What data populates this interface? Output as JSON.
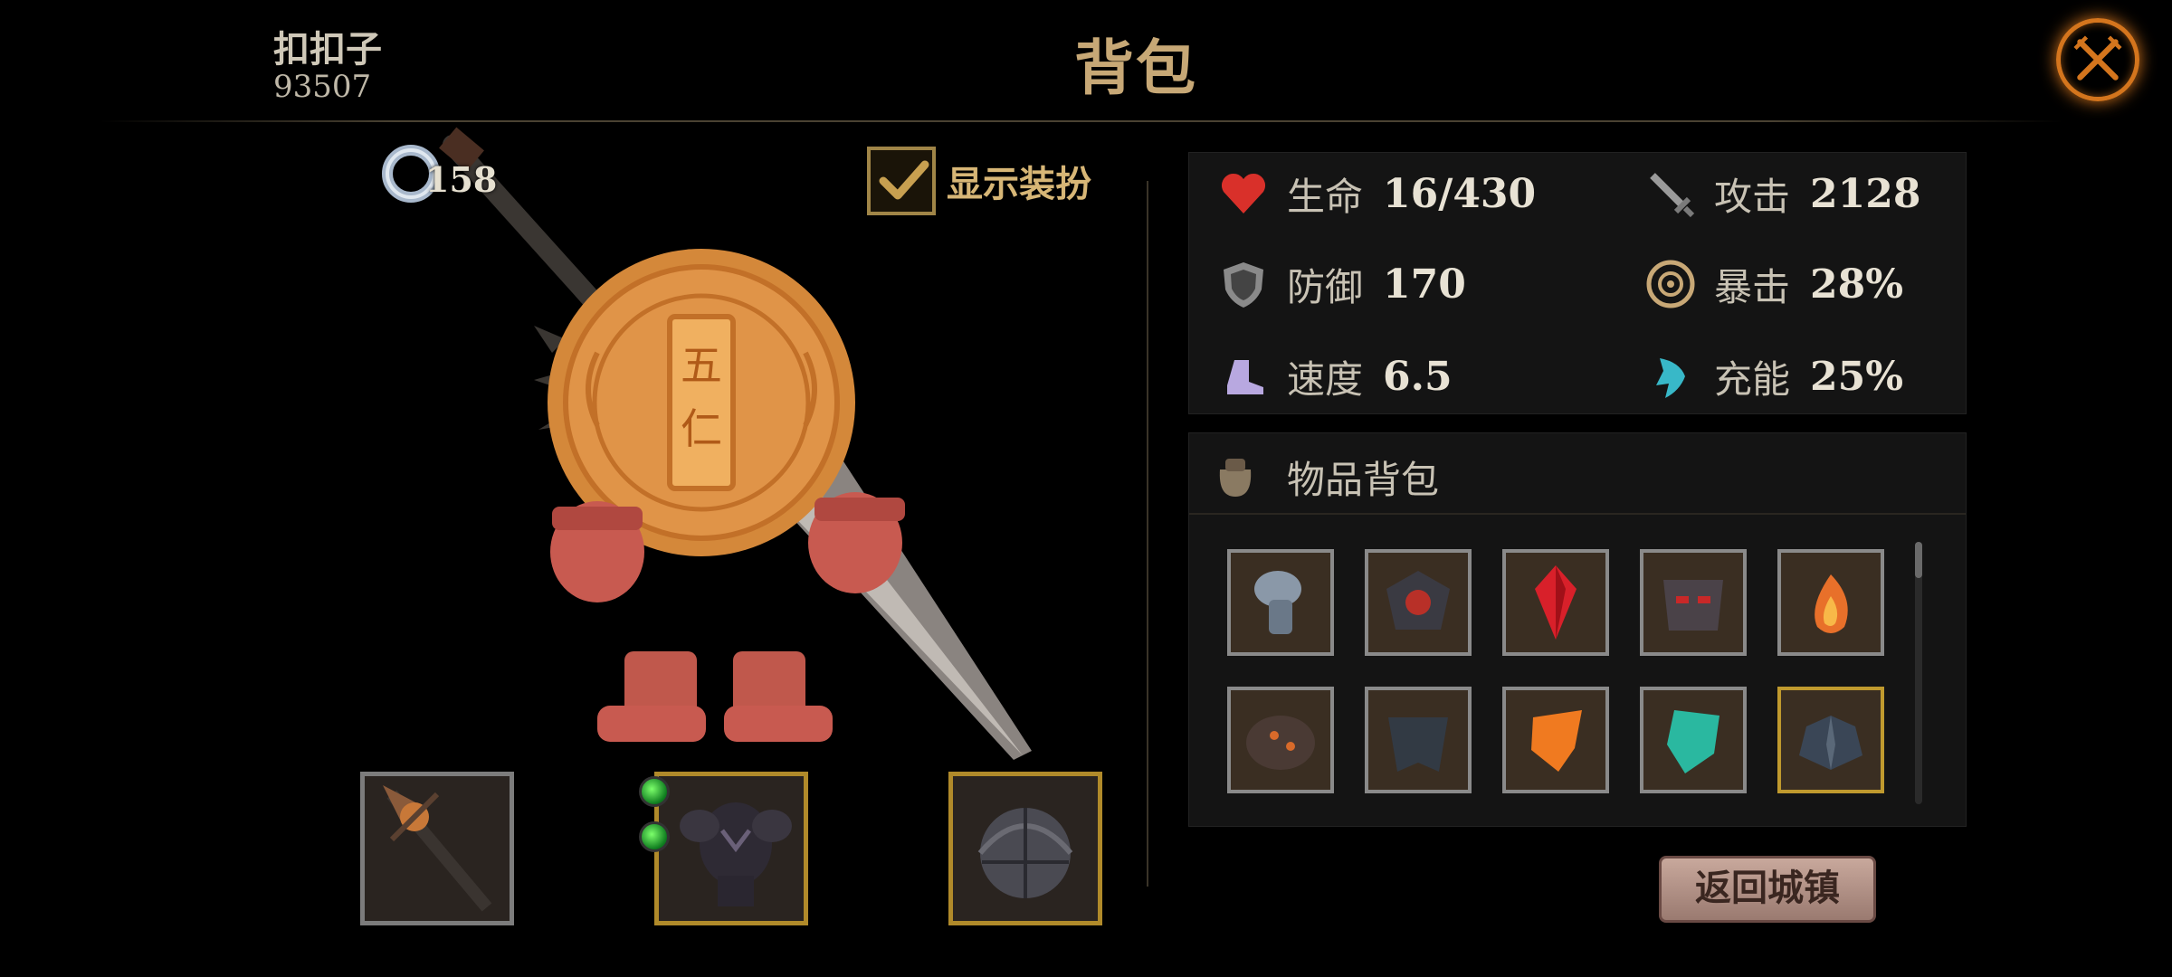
{
  "header": {
    "player_name": "扣扣子",
    "player_id": "93507",
    "title": "背包",
    "close_icon": "crossed-swords-close-icon"
  },
  "character": {
    "level": "158",
    "show_costume_label": "显示装扮",
    "show_costume_checked": true,
    "costume_face_text": "五仁"
  },
  "equipment": [
    {
      "name": "weapon",
      "icon": "spear-icon"
    },
    {
      "name": "armor",
      "icon": "dark-armor-icon",
      "gems": 2
    },
    {
      "name": "helmet",
      "icon": "iron-helmet-icon"
    }
  ],
  "stats": [
    {
      "key": "hp",
      "label": "生命",
      "value": "16/430",
      "icon": "heart-icon",
      "color": "#d9302a"
    },
    {
      "key": "attack",
      "label": "攻击",
      "value": "2128",
      "icon": "sword-icon",
      "color": "#9a9a9a"
    },
    {
      "key": "defense",
      "label": "防御",
      "value": "170",
      "icon": "shield-icon",
      "color": "#9a9a9a"
    },
    {
      "key": "crit",
      "label": "暴击",
      "value": "28%",
      "icon": "crit-target-icon",
      "color": "#c8a876"
    },
    {
      "key": "speed",
      "label": "速度",
      "value": "6.5",
      "icon": "boot-icon",
      "color": "#b8a8e0"
    },
    {
      "key": "charge",
      "label": "充能",
      "value": "25%",
      "icon": "charge-icon",
      "color": "#38b8c8"
    }
  ],
  "inventory": {
    "title": "物品背包",
    "bag_icon": "bag-icon",
    "items": [
      {
        "icon": "gauntlet-icon",
        "frame": "silver"
      },
      {
        "icon": "red-emblem-helmet-icon",
        "frame": "silver"
      },
      {
        "icon": "red-gem-icon",
        "frame": "silver"
      },
      {
        "icon": "dark-mask-icon",
        "frame": "silver"
      },
      {
        "icon": "fire-amulet-icon",
        "frame": "silver"
      },
      {
        "icon": "lava-shell-icon",
        "frame": "silver"
      },
      {
        "icon": "dark-cloak-icon",
        "frame": "silver"
      },
      {
        "icon": "orange-shard-icon",
        "frame": "silver"
      },
      {
        "icon": "teal-shard-icon",
        "frame": "silver"
      },
      {
        "icon": "winged-armor-icon",
        "frame": "gold"
      }
    ]
  },
  "return_button": "返回城镇"
}
